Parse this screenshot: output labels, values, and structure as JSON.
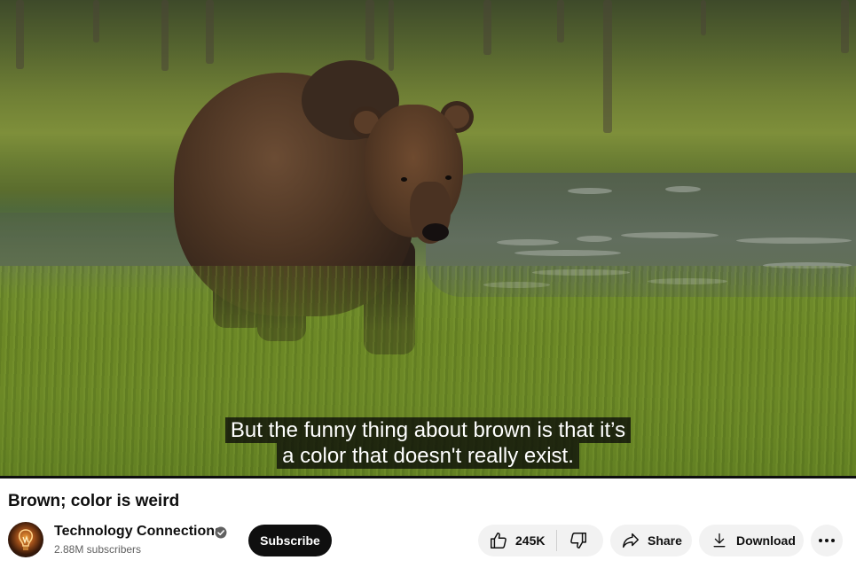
{
  "video": {
    "captions": [
      "But the funny thing about brown is that it’s",
      "a color that doesn't really exist."
    ]
  },
  "title": "Brown; color is weird",
  "channel": {
    "name": "Technology Connections",
    "subscribers": "2.88M subscribers",
    "verified_icon": "verified-check-icon"
  },
  "actions": {
    "subscribe_label": "Subscribe",
    "like_count": "245K",
    "share_label": "Share",
    "download_label": "Download"
  },
  "colors": {
    "primary_text": "#0f0f0f",
    "secondary_text": "#606060",
    "pill_background": "#f2f2f2",
    "subscribe_background": "#0f0f0f"
  }
}
